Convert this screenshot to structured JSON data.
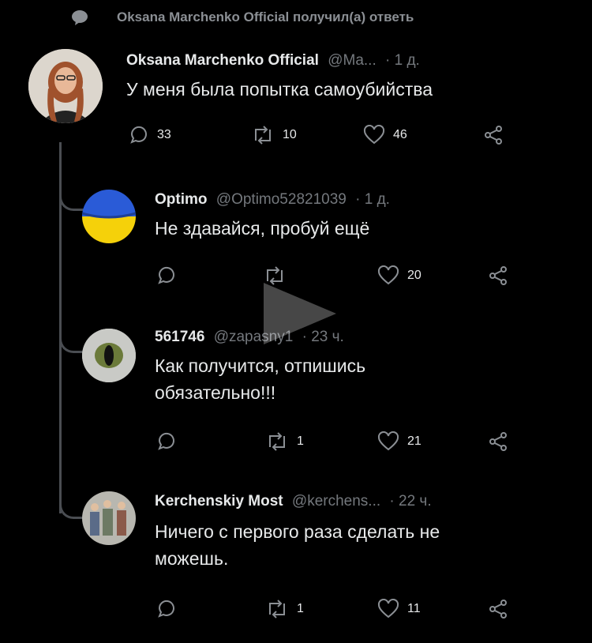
{
  "context": {
    "text": "Oksana Marchenko Official получил(а) ответь"
  },
  "main": {
    "name": "Oksana Marchenko Official",
    "handle": "@Ma...",
    "time": "· 1 д.",
    "text": "У меня была попытка самоубийства",
    "replies": "33",
    "retweets": "10",
    "likes": "46"
  },
  "replies": [
    {
      "name": "Optimo",
      "handle": "@Optimo52821039",
      "time": "· 1 д.",
      "text": "Не здавайся, пробуй ещё",
      "replies": "",
      "retweets": "",
      "likes": "20"
    },
    {
      "name": "561746",
      "handle": "@zapasny1",
      "time": "· 23 ч.",
      "text_line1": "Как получится, отпишись",
      "text_line2": "обязательно!!!",
      "replies": "",
      "retweets": "1",
      "likes": "21"
    },
    {
      "name": "Kerchenskiy Most",
      "handle": "@kerchens...",
      "time": "· 22 ч.",
      "text_line1": "Ничего с первого раза сделать не",
      "text_line2": "можешь.",
      "replies": "",
      "retweets": "1",
      "likes": "11"
    }
  ],
  "colors": {
    "background": "#000000",
    "text": "#e7e9ea",
    "muted": "#74787d",
    "line": "#4a4d52"
  }
}
